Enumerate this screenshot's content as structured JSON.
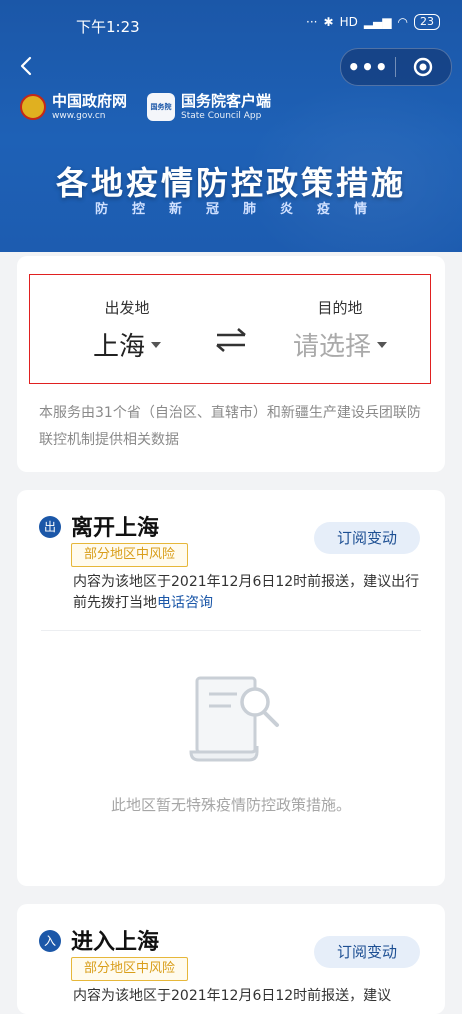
{
  "status_bar": {
    "time": "下午1:23",
    "signal": "HD",
    "battery": "23"
  },
  "header": {
    "logo_gov_name": "中国政府网",
    "logo_gov_url": "www.gov.cn",
    "logo_app_icon": "国务院",
    "logo_app_name": "国务院客户端",
    "logo_app_en": "State Council App",
    "title": "各地疫情防控政策措施",
    "subtitle": "防控新冠肺炎疫情"
  },
  "selector": {
    "from_label": "出发地",
    "from_value": "上海",
    "to_label": "目的地",
    "to_placeholder": "请选择",
    "note": "本服务由31个省（自治区、直辖市）和新疆生产建设兵团联防联控机制提供相关数据"
  },
  "leave": {
    "badge": "出",
    "title": "离开上海",
    "risk": "部分地区中风险",
    "subscribe": "订阅变动",
    "notice_prefix": "内容为该地区于2021年12月6日12时前报送，建议出行前先拨打当地",
    "notice_link": "电话咨询",
    "empty_text": "此地区暂无特殊疫情防控政策措施。"
  },
  "enter": {
    "badge": "入",
    "title": "进入上海",
    "risk": "部分地区中风险",
    "subscribe": "订阅变动",
    "notice_prefix": "内容为该地区于2021年12月6日12时前报送，建议"
  },
  "colors": {
    "header_blue": "#1b57a8",
    "highlight_red": "#e02020",
    "risk_yellow": "#d99e1a",
    "subscribe_bg": "#e6eef9"
  }
}
